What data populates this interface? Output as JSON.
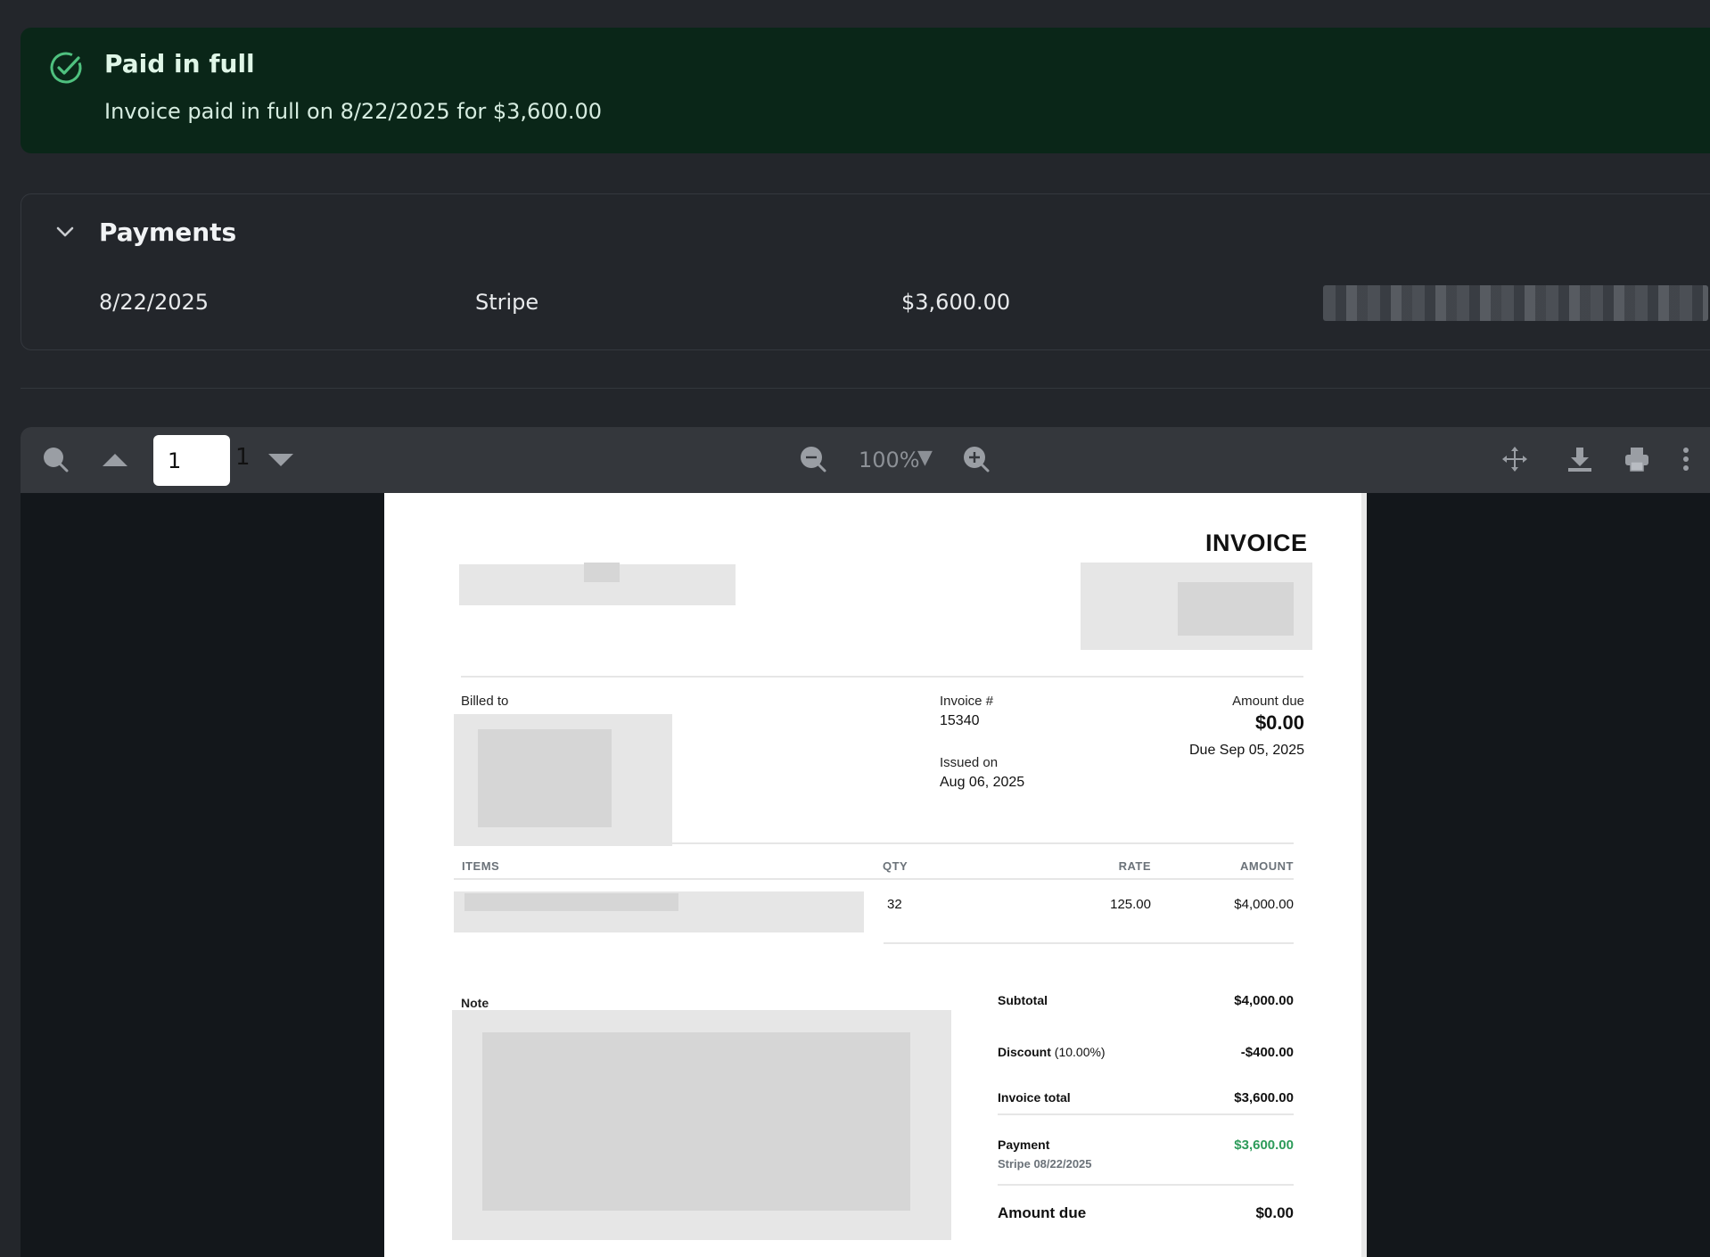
{
  "banner": {
    "title": "Paid in full",
    "message": "Invoice paid in full on 8/22/2025 for $3,600.00",
    "accent": "#4fc17f"
  },
  "payments": {
    "title": "Payments",
    "rows": [
      {
        "date": "8/22/2025",
        "method": "Stripe",
        "amount": "$3,600.00"
      }
    ]
  },
  "viewer": {
    "page_input": "1",
    "page_total": "1",
    "zoom": "100%",
    "zoom_arrow": "▼",
    "icons": [
      "search-icon",
      "page-up-icon",
      "page-down-icon",
      "zoom-out-icon",
      "zoom-in-icon",
      "pan-icon",
      "download-icon",
      "print-icon",
      "more-icon"
    ]
  },
  "invoice": {
    "title": "INVOICE",
    "billed_to_label": "Billed to",
    "invoice_no_label": "Invoice #",
    "invoice_no": "15340",
    "issued_label": "Issued on",
    "issued_date": "Aug 06, 2025",
    "amount_due_label": "Amount due",
    "amount_due": "$0.00",
    "due_date": "Due Sep 05, 2025",
    "columns": {
      "items": "ITEMS",
      "qty": "QTY",
      "rate": "RATE",
      "amount": "AMOUNT"
    },
    "line_items": [
      {
        "qty": "32",
        "rate": "125.00",
        "amount": "$4,000.00"
      }
    ],
    "note_label": "Note",
    "subtotal_label": "Subtotal",
    "subtotal": "$4,000.00",
    "discount_label": "Discount",
    "discount_pct": "(10.00%)",
    "discount": "-$400.00",
    "total_label": "Invoice total",
    "total": "$3,600.00",
    "payment_label": "Payment",
    "payment_sub": "Stripe 08/22/2025",
    "payment_amount": "$3,600.00",
    "final_due_label": "Amount due",
    "final_due": "$0.00"
  }
}
